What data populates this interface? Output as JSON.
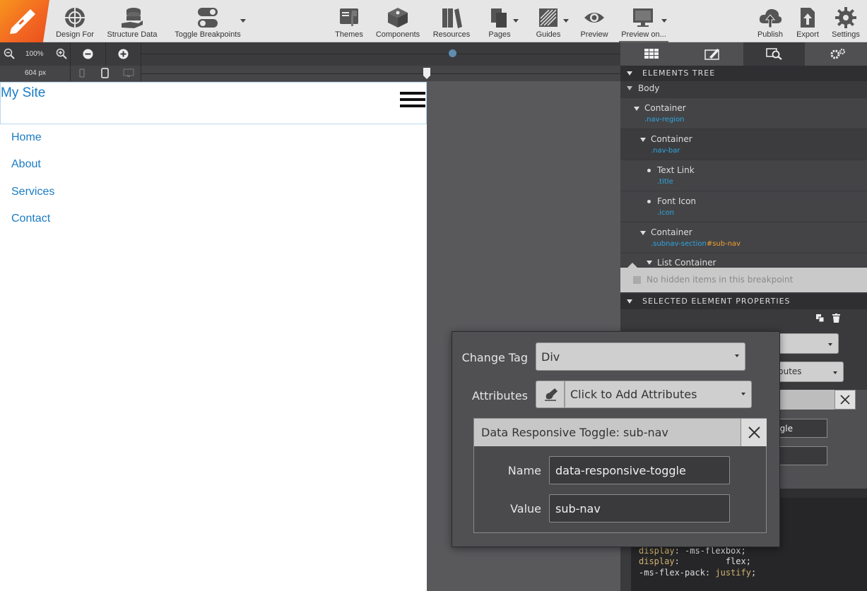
{
  "toolbar": {
    "items": [
      {
        "label": "Design For",
        "icon": "crosshair-icon"
      },
      {
        "label": "Structure Data",
        "icon": "stack-hand-icon"
      },
      {
        "label": "Toggle Breakpoints",
        "icon": "toggle-icon"
      },
      {
        "label": "Themes",
        "icon": "themes-icon"
      },
      {
        "label": "Components",
        "icon": "components-icon"
      },
      {
        "label": "Resources",
        "icon": "books-icon"
      },
      {
        "label": "Pages",
        "icon": "pages-icon"
      },
      {
        "label": "Guides",
        "icon": "guides-icon"
      },
      {
        "label": "Preview",
        "icon": "eye-icon"
      },
      {
        "label": "Preview on...",
        "icon": "monitor-icon"
      },
      {
        "label": "Publish",
        "icon": "cloud-upload-icon"
      },
      {
        "label": "Export",
        "icon": "export-icon"
      },
      {
        "label": "Settings",
        "icon": "gear-icon"
      }
    ]
  },
  "zoom": {
    "level": "100%"
  },
  "breakpoint": {
    "width": "604 px"
  },
  "canvas": {
    "site_title": "My Site",
    "nav_items": [
      "Home",
      "About",
      "Services",
      "Contact"
    ]
  },
  "panel": {
    "elements_tree_title": "ELEMENTS TREE",
    "tree": [
      {
        "name": "Body",
        "cls": "",
        "id": ""
      },
      {
        "name": "Container",
        "cls": ".nav-region",
        "id": ""
      },
      {
        "name": "Container",
        "cls": ".nav-bar",
        "id": ""
      },
      {
        "name": "Text Link",
        "cls": ".title",
        "id": ""
      },
      {
        "name": "Font Icon",
        "cls": ".icon",
        "id": ""
      },
      {
        "name": "Container",
        "cls": ".subnav-section",
        "id": "#sub-nav"
      },
      {
        "name": "List Container",
        "cls": "",
        "id": ""
      }
    ],
    "hidden_items_text": "No hidden items in this breakpoint",
    "selected_props_title": "SELECTED ELEMENT PROPERTIES",
    "behind_attr_select": "butes",
    "behind_field_value": "ggle"
  },
  "popup": {
    "change_tag_label": "Change Tag",
    "tag_value": "Div",
    "attributes_label": "Attributes",
    "attributes_placeholder": "Click to Add Attributes",
    "attr_card_title": "Data Responsive Toggle: sub-nav",
    "name_label": "Name",
    "name_value": "data-responsive-toggle",
    "value_label": "Value",
    "value_value": "sub-nav"
  },
  "code": {
    "lines": [
      {
        "prop": "display",
        "val": "-ms-flexbox"
      },
      {
        "prop": "display",
        "val": "flex"
      },
      {
        "prop": "-ms-flex-pack",
        "val": "justify"
      }
    ]
  },
  "colors": {
    "accent": "#2ea7e0",
    "link": "#1a7cc3",
    "logo": "#f26522"
  }
}
